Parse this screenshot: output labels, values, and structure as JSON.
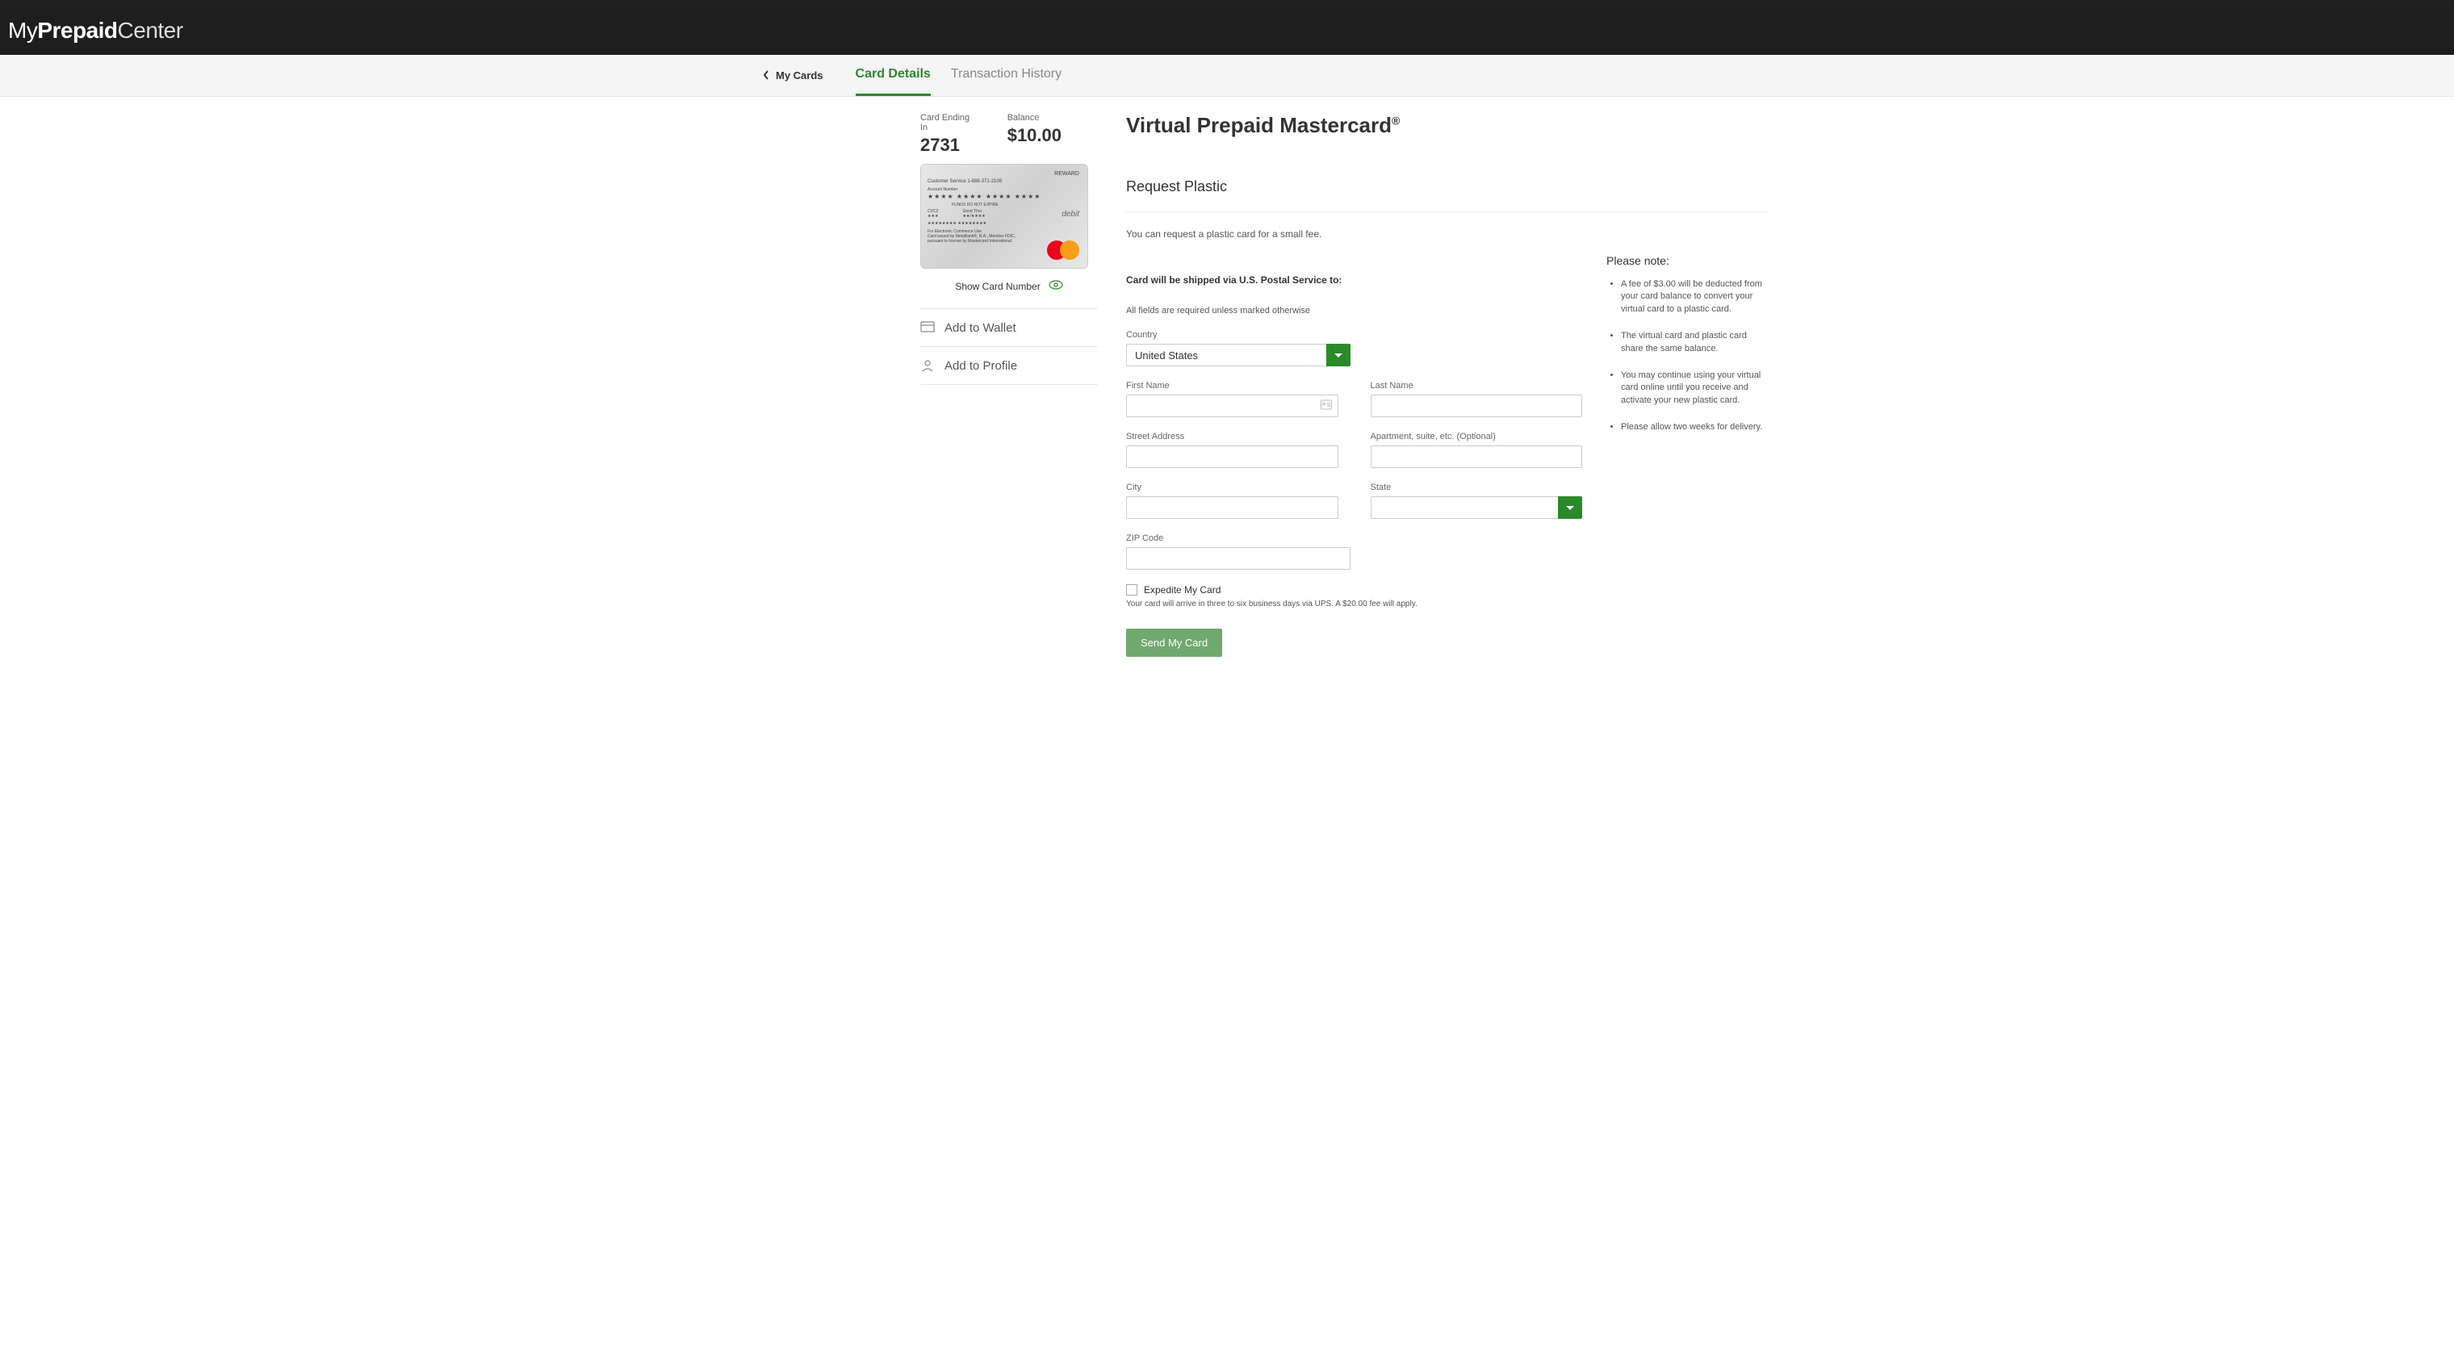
{
  "header": {
    "logo_pre": "My",
    "logo_mid": "Prepaid",
    "logo_suf": "Center"
  },
  "nav": {
    "back": "My Cards",
    "tabs": [
      {
        "label": "Card Details",
        "active": true
      },
      {
        "label": "Transaction History",
        "active": false
      }
    ]
  },
  "card_info": {
    "ending_label": "Card Ending In",
    "ending_value": "2731",
    "balance_label": "Balance",
    "balance_value": "$10.00"
  },
  "card_face": {
    "reward": "REWARD",
    "cs": "Customer Service 1-888-371-2109",
    "account_lbl": "Account Number",
    "masked": "★★★★  ★★★★  ★★★★  ★★★★",
    "debit": "debit",
    "funds": "FUNDS DO NOT EXPIRE",
    "cvc_lbl": "CVC2",
    "cvc": "★★★",
    "good_lbl": "Good Thru",
    "good": "★★/★★★★",
    "name": "★★★★★★★★  ★★★★★★★★",
    "fine1": "For Electronic Commerce Use",
    "fine2": "Card issued by MetaBank®, N.A., Member FDIC,",
    "fine3": "pursuant to license by Mastercard International."
  },
  "show_number": "Show Card Number",
  "actions": {
    "wallet": "Add to Wallet",
    "profile": "Add to Profile"
  },
  "main": {
    "title": "Virtual Prepaid Mastercard",
    "title_sup": "®",
    "section": "Request Plastic",
    "intro": "You can request a plastic card for a small fee.",
    "ship_note": "Card will be shipped via U.S. Postal Service to:",
    "required_note": "All fields are required unless marked otherwise"
  },
  "form": {
    "country_label": "Country",
    "country_value": "United States",
    "first_name_label": "First Name",
    "last_name_label": "Last Name",
    "street_label": "Street Address",
    "apt_label": "Apartment, suite, etc. (Optional)",
    "city_label": "City",
    "state_label": "State",
    "zip_label": "ZIP Code",
    "expedite_label": "Expedite My Card",
    "expedite_note": "Your card will arrive in three to six business days via UPS. A $20.00 fee will apply.",
    "submit": "Send My Card"
  },
  "notes": {
    "title": "Please note:",
    "items": [
      "A fee of $3.00 will be deducted from your card balance to convert your virtual card to a plastic card.",
      "The virtual card and plastic card share the same balance.",
      "You may continue using your virtual card online until you receive and activate your new plastic card.",
      "Please allow two weeks for delivery."
    ]
  }
}
